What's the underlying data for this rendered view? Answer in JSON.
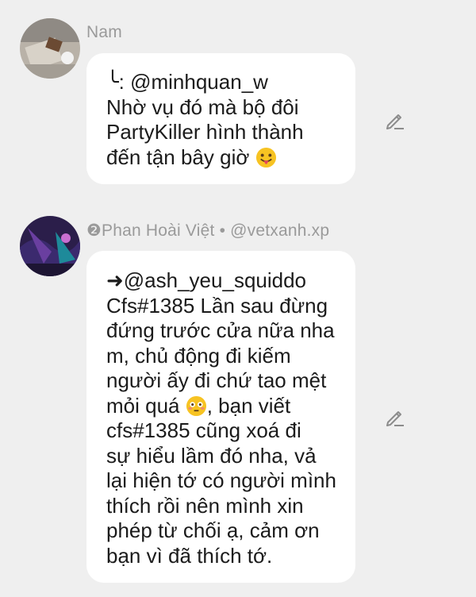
{
  "messages": [
    {
      "author": "Nam",
      "lines": [
        "╰: @minhquan_w",
        "Nhờ vụ đó mà bộ đôi",
        "PartyKiller hình thành",
        "đến tận bây giờ"
      ],
      "emoji": "tongue-out-face-emoji"
    },
    {
      "author": "❷Phan Hoài Việt • @vetxanh.xp",
      "lines": [
        "➜@ash_yeu_squiddo",
        "Cfs#1385 Lần sau đừng",
        "đứng trước cửa nữa nha",
        "m, chủ động đi kiếm",
        "người ấy đi chứ tao mệt",
        "mỏi quá",
        ", bạn viết",
        "cfs#1385 cũng xoá đi",
        "sự hiểu lầm đó nha, vả",
        "lại hiện tớ có người mình",
        "thích rồi nên mình xin",
        "phép từ chối ạ, cảm ơn",
        "bạn vì đã thích tớ."
      ],
      "emoji": "flushed-face-emoji"
    }
  ],
  "icons": {
    "edit": "pencil-edit-icon"
  },
  "colors": {
    "background": "#efefef",
    "bubble": "#ffffff",
    "author_text": "#9a9a9a",
    "message_text": "#1b1b1b",
    "edit_icon": "#8c8c8c"
  }
}
